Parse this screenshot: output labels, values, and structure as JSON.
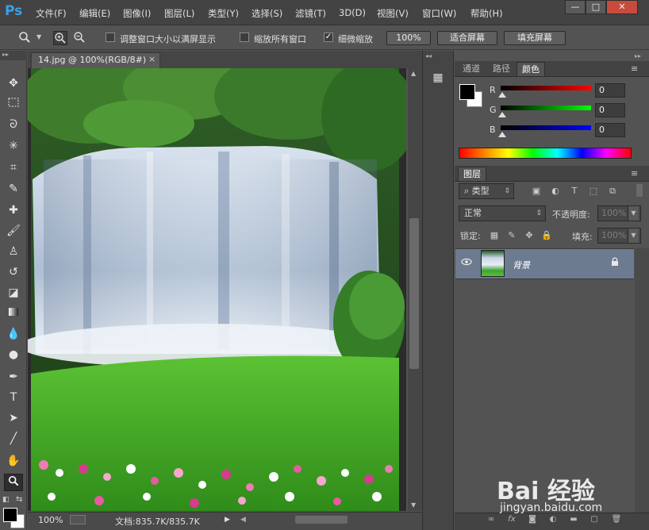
{
  "app": {
    "logo": "Ps"
  },
  "menu": [
    "文件(F)",
    "编辑(E)",
    "图像(I)",
    "图层(L)",
    "类型(Y)",
    "选择(S)",
    "滤镜(T)",
    "3D(D)",
    "视图(V)",
    "窗口(W)",
    "帮助(H)"
  ],
  "window_controls": {
    "minimize": "—",
    "maximize": "□",
    "close": "✕"
  },
  "options": {
    "tool_icon": "zoom-icon",
    "resize_windows_label": "调整窗口大小以满屏显示",
    "resize_windows_checked": false,
    "zoom_all_label": "缩放所有窗口",
    "zoom_all_checked": false,
    "scrubby_label": "细微缩放",
    "scrubby_checked": true,
    "btn_100": "100%",
    "btn_fit": "适合屏幕",
    "btn_fill": "填充屏幕"
  },
  "tools": [
    "move-tool",
    "marquee-tool",
    "lasso-tool",
    "magic-wand-tool",
    "crop-tool",
    "eyedropper-tool",
    "healing-brush-tool",
    "brush-tool",
    "clone-stamp-tool",
    "history-brush-tool",
    "eraser-tool",
    "gradient-tool",
    "blur-tool",
    "dodge-tool",
    "pen-tool",
    "type-tool",
    "path-selection-tool",
    "line-tool",
    "hand-tool",
    "zoom-tool"
  ],
  "colors": {
    "foreground": "#000000",
    "background": "#ffffff",
    "accent_layer": "#6d7b91",
    "ps_blue": "#3aa0e8"
  },
  "document": {
    "tab_title": "14.jpg @ 100%(RGB/8#)",
    "close": "×",
    "zoom": "100%",
    "doc_size": "文档:835.7K/835.7K",
    "image_description": "waterfall-landscape-photo"
  },
  "color_panel": {
    "tabs": [
      "通道",
      "路径",
      "颜色"
    ],
    "active_tab": "颜色",
    "channels": [
      {
        "label": "R",
        "value": "0",
        "color": "#cc1b1b"
      },
      {
        "label": "G",
        "value": "0",
        "color": "#1bcc33"
      },
      {
        "label": "B",
        "value": "0",
        "color": "#1b2bcc"
      }
    ]
  },
  "layers_panel": {
    "tab": "图层",
    "filter_label": "类型",
    "blend_mode": "正常",
    "opacity_label": "不透明度:",
    "opacity_value": "100%",
    "lock_label": "锁定:",
    "fill_label": "填充:",
    "fill_value": "100%",
    "layers": [
      {
        "name": "背景",
        "visible": true,
        "locked": true
      }
    ]
  },
  "watermark": {
    "brand": "Bai 经验",
    "url": "jingyan.baidu.com"
  }
}
